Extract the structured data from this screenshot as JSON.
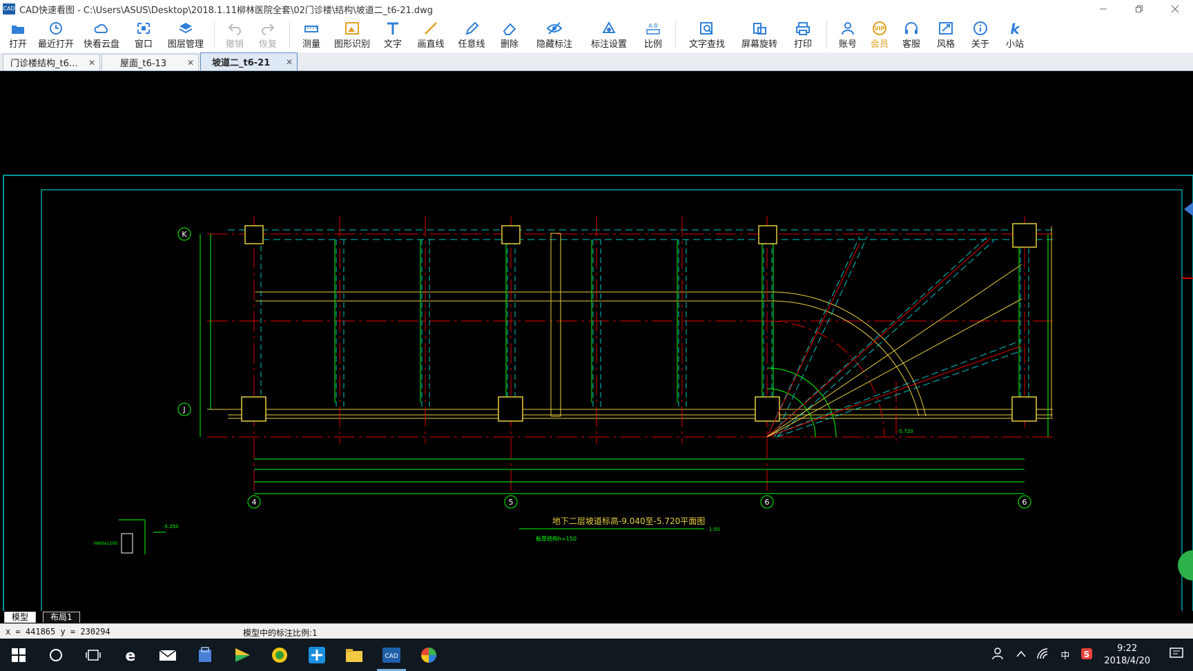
{
  "window": {
    "title": "CAD快速看图 - C:\\Users\\ASUS\\Desktop\\2018.1.11柳林医院全套\\02门诊楼\\结构\\坡道二_t6-21.dwg",
    "logo_text": "CAD"
  },
  "toolbar": {
    "items": [
      {
        "label": "打开",
        "icon": "folder-open-icon",
        "enabled": true
      },
      {
        "label": "最近打开",
        "icon": "clock-icon",
        "enabled": true
      },
      {
        "label": "快看云盘",
        "icon": "cloud-icon",
        "enabled": true
      },
      {
        "label": "窗口",
        "icon": "window-icon",
        "enabled": true
      },
      {
        "label": "图层管理",
        "icon": "layers-icon",
        "enabled": true
      },
      {
        "label": "撤销",
        "icon": "undo-icon",
        "enabled": false
      },
      {
        "label": "恢复",
        "icon": "redo-icon",
        "enabled": false
      },
      {
        "label": "测量",
        "icon": "ruler-icon",
        "enabled": true
      },
      {
        "label": "图形识别",
        "icon": "shape-recognize-icon",
        "enabled": true
      },
      {
        "label": "文字",
        "icon": "text-icon",
        "enabled": true
      },
      {
        "label": "画直线",
        "icon": "line-icon",
        "enabled": true
      },
      {
        "label": "任意线",
        "icon": "pen-icon",
        "enabled": true
      },
      {
        "label": "删除",
        "icon": "eraser-icon",
        "enabled": true
      },
      {
        "label": "隐藏标注",
        "icon": "eye-icon",
        "enabled": true
      },
      {
        "label": "标注设置",
        "icon": "annotation-settings-icon",
        "enabled": true
      },
      {
        "label": "比例",
        "icon": "scale-icon",
        "enabled": true
      },
      {
        "label": "文字查找",
        "icon": "text-search-icon",
        "enabled": true
      },
      {
        "label": "屏幕旋转",
        "icon": "rotate-screen-icon",
        "enabled": true
      },
      {
        "label": "打印",
        "icon": "printer-icon",
        "enabled": true
      },
      {
        "label": "账号",
        "icon": "user-icon",
        "enabled": true
      },
      {
        "label": "会员",
        "icon": "vip-icon",
        "enabled": true
      },
      {
        "label": "客服",
        "icon": "headset-icon",
        "enabled": true
      },
      {
        "label": "风格",
        "icon": "style-icon",
        "enabled": true
      },
      {
        "label": "关于",
        "icon": "info-icon",
        "enabled": true
      },
      {
        "label": "小站",
        "icon": "k-site-icon",
        "enabled": true
      }
    ]
  },
  "tabs": [
    {
      "label": "门诊楼结构_t6…",
      "active": false
    },
    {
      "label": "屋面_t6-13",
      "active": false
    },
    {
      "label": "坡道二_t6-21",
      "active": true
    }
  ],
  "drawing": {
    "grid_labels": {
      "k": "K",
      "j": "J",
      "a": "4",
      "b": "5",
      "c": "6",
      "d": "6"
    },
    "plan_title": "地下二层坡道标高-9.040至-5.720平面图",
    "plan_scale_note": "1:50",
    "plan_subnote": "板厚结构h=150",
    "elevation_tags": [
      "-5.250",
      "-5.720"
    ],
    "detail_note": "h800x1200"
  },
  "layout_tabs": {
    "model": "模型",
    "layout1": "布局1"
  },
  "status": {
    "coords": "x = 441865  y = 230294",
    "scale_text": "模型中的标注比例:1"
  },
  "taskbar": {
    "ime": "中",
    "time": "9:22",
    "date": "2018/4/20"
  },
  "colors": {
    "cyan": "#00c8c8",
    "green": "#00ff00",
    "red": "#e00000",
    "yellow": "#e8d040",
    "orange": "#e0a020"
  }
}
